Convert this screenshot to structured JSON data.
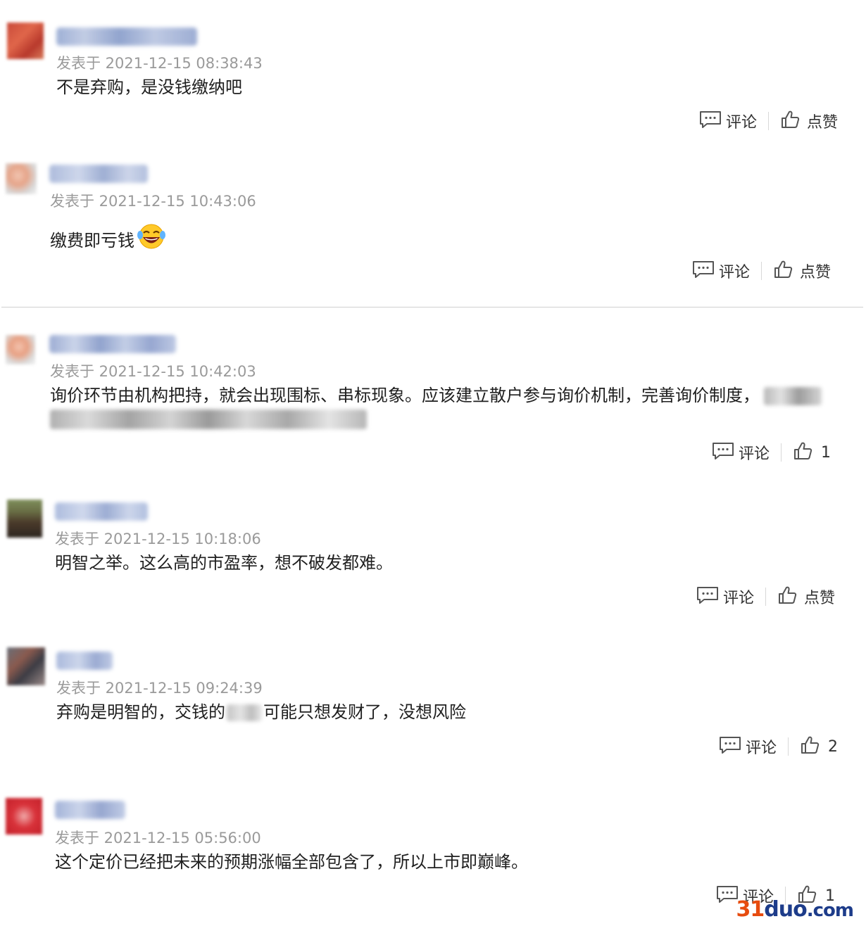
{
  "actions": {
    "comment_label": "评论",
    "like_label": "点赞"
  },
  "comments": [
    {
      "timestamp": "发表于 2021-12-15 08:38:43",
      "text": "不是弃购，是没钱缴纳吧",
      "like_text": "点赞"
    },
    {
      "timestamp": "发表于 2021-12-15 10:43:06",
      "text": "缴费即亏钱",
      "emoji": "laughing-tears-emoji",
      "like_text": "点赞"
    },
    {
      "timestamp": "发表于 2021-12-15 10:42:03",
      "text": "询价环节由机构把持，就会出现围标、串标现象。应该建立散户参与询价机制，完善询价制度，",
      "like_text": "1"
    },
    {
      "timestamp": "发表于 2021-12-15 10:18:06",
      "text": "明智之举。这么高的市盈率，想不破发都难。",
      "like_text": "点赞"
    },
    {
      "timestamp": "发表于 2021-12-15 09:24:39",
      "text_before": "弃购是明智的，交钱的",
      "text_after": "可能只想发财了，没想风险",
      "like_text": "2"
    },
    {
      "timestamp": "发表于 2021-12-15 05:56:00",
      "text": "这个定价已经把未来的预期涨幅全部包含了，所以上市即巅峰。",
      "like_text": "1"
    }
  ],
  "watermark": {
    "num": "31",
    "rest": "duo",
    "tld": ".com"
  },
  "colors": {
    "timestamp": "#9a9a9a",
    "icon": "#555555",
    "watermark_num": "#e74c0f",
    "watermark_text": "#1d3c8a"
  }
}
